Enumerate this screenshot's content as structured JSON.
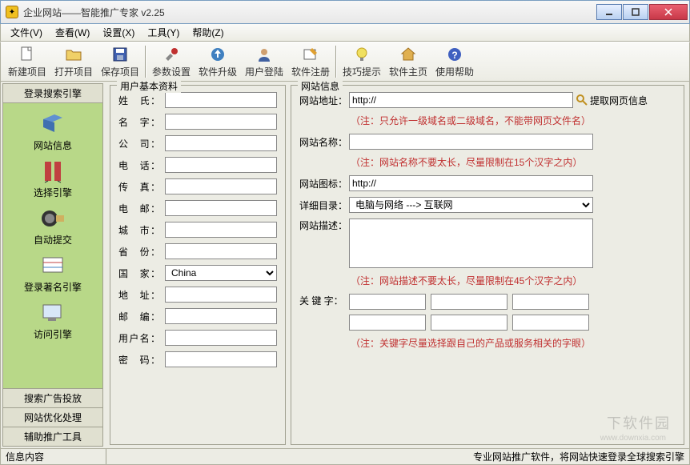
{
  "window": {
    "title": "企业网站——智能推广专家 v2.25"
  },
  "menu": {
    "items": [
      "文件(V)",
      "查看(W)",
      "设置(X)",
      "工具(Y)",
      "帮助(Z)"
    ]
  },
  "toolbar": {
    "items": [
      {
        "label": "新建项目",
        "icon": "file-new"
      },
      {
        "label": "打开项目",
        "icon": "folder-open"
      },
      {
        "label": "保存项目",
        "icon": "disk-save"
      },
      {
        "label": "参数设置",
        "icon": "tools"
      },
      {
        "label": "软件升级",
        "icon": "upgrade"
      },
      {
        "label": "用户登陆",
        "icon": "user"
      },
      {
        "label": "软件注册",
        "icon": "register"
      },
      {
        "label": "技巧提示",
        "icon": "tip"
      },
      {
        "label": "软件主页",
        "icon": "home"
      },
      {
        "label": "使用帮助",
        "icon": "help"
      }
    ]
  },
  "sidebar": {
    "header": "登录搜索引擎",
    "items": [
      {
        "label": "网站信息"
      },
      {
        "label": "选择引擎"
      },
      {
        "label": "自动提交"
      },
      {
        "label": "登录著名引擎"
      },
      {
        "label": "访问引擎"
      }
    ],
    "footer": [
      "搜索广告投放",
      "网站优化处理",
      "辅助推广工具"
    ]
  },
  "userGroup": {
    "title": "用户基本资料",
    "fields": {
      "lastName": {
        "label": "姓　氏：",
        "value": ""
      },
      "firstName": {
        "label": "名　字：",
        "value": ""
      },
      "company": {
        "label": "公　司：",
        "value": ""
      },
      "phone": {
        "label": "电　话：",
        "value": ""
      },
      "fax": {
        "label": "传　真：",
        "value": ""
      },
      "email": {
        "label": "电　邮：",
        "value": ""
      },
      "city": {
        "label": "城　市：",
        "value": ""
      },
      "province": {
        "label": "省　份：",
        "value": ""
      },
      "country": {
        "label": "国　家：",
        "value": "China"
      },
      "address": {
        "label": "地　址：",
        "value": ""
      },
      "postcode": {
        "label": "邮　编：",
        "value": ""
      },
      "username": {
        "label": "用户名：",
        "value": ""
      },
      "password": {
        "label": "密　码：",
        "value": ""
      }
    }
  },
  "siteGroup": {
    "title": "网站信息",
    "url": {
      "label": "网站地址：",
      "value": "http://"
    },
    "fetch": "提取网页信息",
    "note1": "（注：只允许一级域名或二级域名，不能带网页文件名）",
    "name": {
      "label": "网站名称：",
      "value": ""
    },
    "note2": "（注：网站名称不要太长，尽量限制在15个汉字之内）",
    "iconUrl": {
      "label": "网站图标：",
      "value": "http://"
    },
    "category": {
      "label": "详细目录：",
      "value": "电脑与网络 ---> 互联网"
    },
    "desc": {
      "label": "网站描述：",
      "value": ""
    },
    "note3": "（注：网站描述不要太长，尽量限制在45个汉字之内）",
    "keywords": {
      "label": "关 键 字：",
      "values": [
        "",
        "",
        "",
        "",
        "",
        ""
      ]
    },
    "note4": "（注：关键字尽量选择跟自己的产品或服务相关的字眼）"
  },
  "status": {
    "left": "信息内容",
    "right": "专业网站推广软件，将网站快速登录全球搜索引擎"
  },
  "watermark": {
    "main": "下软件园",
    "sub": "www.downxia.com"
  }
}
